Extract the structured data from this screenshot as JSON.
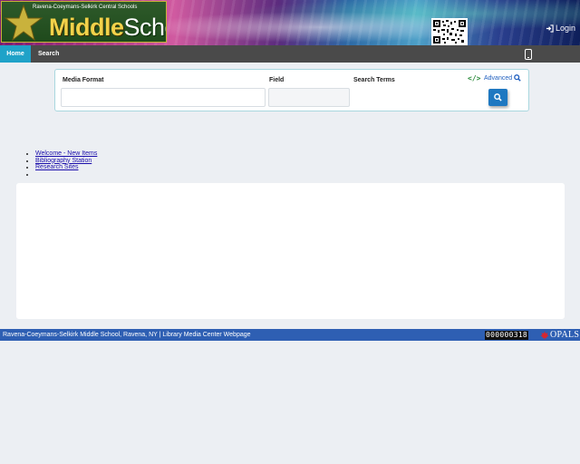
{
  "header": {
    "logo": {
      "top_line": "Ravena-Coeymans-Selkirk Central Schools",
      "word1": "Middle",
      "word2": "School"
    },
    "qr_code": "qr-code-image",
    "login_label": "Login",
    "login_icon": "sign-in-icon"
  },
  "nav": {
    "items": [
      {
        "label": "Home",
        "active": true
      },
      {
        "label": "Search",
        "active": false
      }
    ],
    "mobile_icon": "mobile-phone-icon",
    "active_color": "#1fa2c8"
  },
  "search": {
    "media_format_label": "Media Format",
    "field_label": "Field",
    "search_terms_label": "Search Terms",
    "media_format_value": "",
    "field_value": "",
    "embed_icon": "code-icon",
    "advanced_label": "Advanced",
    "search_button_icon": "search-icon",
    "button_color": "#1f78c1"
  },
  "links": [
    {
      "label": "Welcome - New Items"
    },
    {
      "label": "Bibliography Station"
    },
    {
      "label": "Research Sites"
    },
    {
      "label": ""
    }
  ],
  "footer": {
    "text": "Ravena-Coeymans-Selkirk Middle School, Ravena, NY | Library Media Center Webpage",
    "counter": "000000318",
    "brand": "OPALS",
    "brand_icon": "maple-leaf-icon",
    "color": "#2e5fb3"
  }
}
